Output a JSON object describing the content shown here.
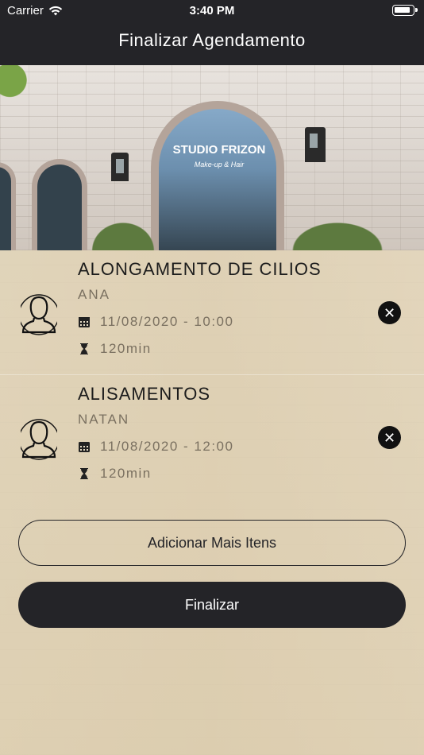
{
  "status_bar": {
    "carrier": "Carrier",
    "time": "3:40 PM"
  },
  "nav": {
    "title": "Finalizar Agendamento"
  },
  "hero": {
    "sign_title": "STUDIO FRIZON",
    "sign_subtitle": "Make-up & Hair"
  },
  "items": [
    {
      "service": "ALONGAMENTO DE CILIOS",
      "professional": "ANA",
      "datetime": "11/08/2020 - 10:00",
      "duration": "120min"
    },
    {
      "service": "ALISAMENTOS",
      "professional": "NATAN",
      "datetime": "11/08/2020 - 12:00",
      "duration": "120min"
    }
  ],
  "buttons": {
    "add_more": "Adicionar Mais Itens",
    "finish": "Finalizar"
  },
  "colors": {
    "nav_bg": "#242428",
    "accent_dark": "#242428",
    "muted_text": "#7a7060"
  },
  "icons": {
    "avatar": "person-outline-icon",
    "calendar": "calendar-icon",
    "duration": "hourglass-icon",
    "remove": "close-circle-icon",
    "wifi": "wifi-icon",
    "battery": "battery-icon"
  }
}
